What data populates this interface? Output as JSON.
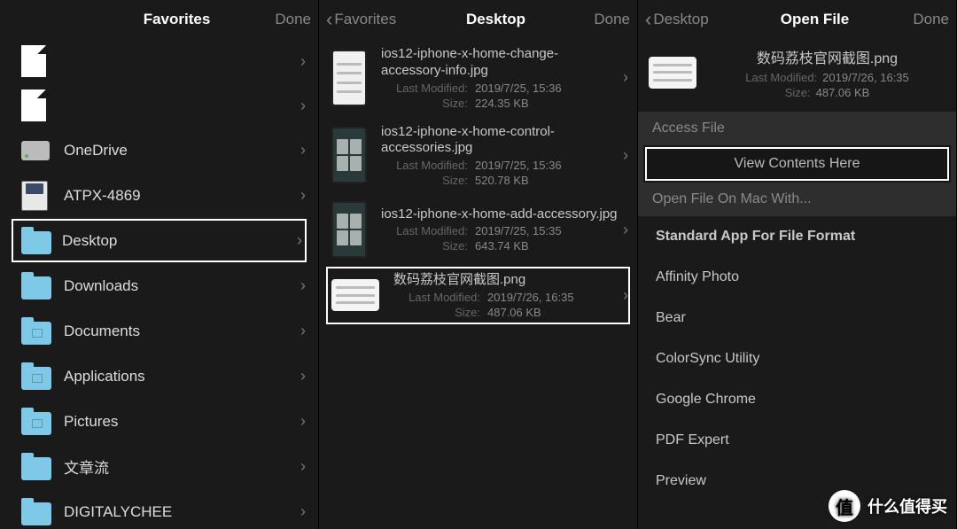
{
  "pane1": {
    "title": "Favorites",
    "done": "Done",
    "items": [
      {
        "kind": "doc",
        "label": ""
      },
      {
        "kind": "doc",
        "label": ""
      },
      {
        "kind": "drive",
        "label": "OneDrive"
      },
      {
        "kind": "disk",
        "label": "ATPX-4869"
      },
      {
        "kind": "folder",
        "label": "Desktop",
        "selected": true
      },
      {
        "kind": "folder",
        "label": "Downloads"
      },
      {
        "kind": "folder",
        "label": "Documents"
      },
      {
        "kind": "folder",
        "label": "Applications"
      },
      {
        "kind": "folder",
        "label": "Pictures"
      },
      {
        "kind": "folder",
        "label": "文章流"
      },
      {
        "kind": "folder",
        "label": "DIGITALYCHEE"
      }
    ]
  },
  "pane2": {
    "back": "Favorites",
    "title": "Desktop",
    "done": "Done",
    "meta_labels": {
      "modified": "Last Modified:",
      "size": "Size:"
    },
    "files": [
      {
        "name": "ios12-iphone-x-home-change-accessory-info.jpg",
        "modified": "2019/7/25, 15:36",
        "size": "224.35 KB",
        "thumb": "phone-light"
      },
      {
        "name": "ios12-iphone-x-home-control-accessories.jpg",
        "modified": "2019/7/25, 15:36",
        "size": "520.78 KB",
        "thumb": "phone-dark"
      },
      {
        "name": "ios12-iphone-x-home-add-accessory.jpg",
        "modified": "2019/7/25, 15:35",
        "size": "643.74 KB",
        "thumb": "phone-dark"
      },
      {
        "name": "数码荔枝官网截图.png",
        "modified": "2019/7/26, 16:35",
        "size": "487.06 KB",
        "thumb": "landscape",
        "selected": true
      }
    ]
  },
  "pane3": {
    "back": "Desktop",
    "title": "Open File",
    "done": "Done",
    "file": {
      "name": "数码荔枝官网截图.png",
      "modified": "2019/7/26, 16:35",
      "size": "487.06 KB"
    },
    "meta_labels": {
      "modified": "Last Modified:",
      "size": "Size:"
    },
    "section_access": "Access File",
    "view_contents": "View Contents Here",
    "section_openwith": "Open File On Mac With...",
    "apps": [
      "Standard App For File Format",
      "Affinity Photo",
      "Bear",
      "ColorSync Utility",
      "Google Chrome",
      "PDF Expert",
      "Preview"
    ]
  },
  "watermark": {
    "badge": "值",
    "text": "什么值得买"
  }
}
